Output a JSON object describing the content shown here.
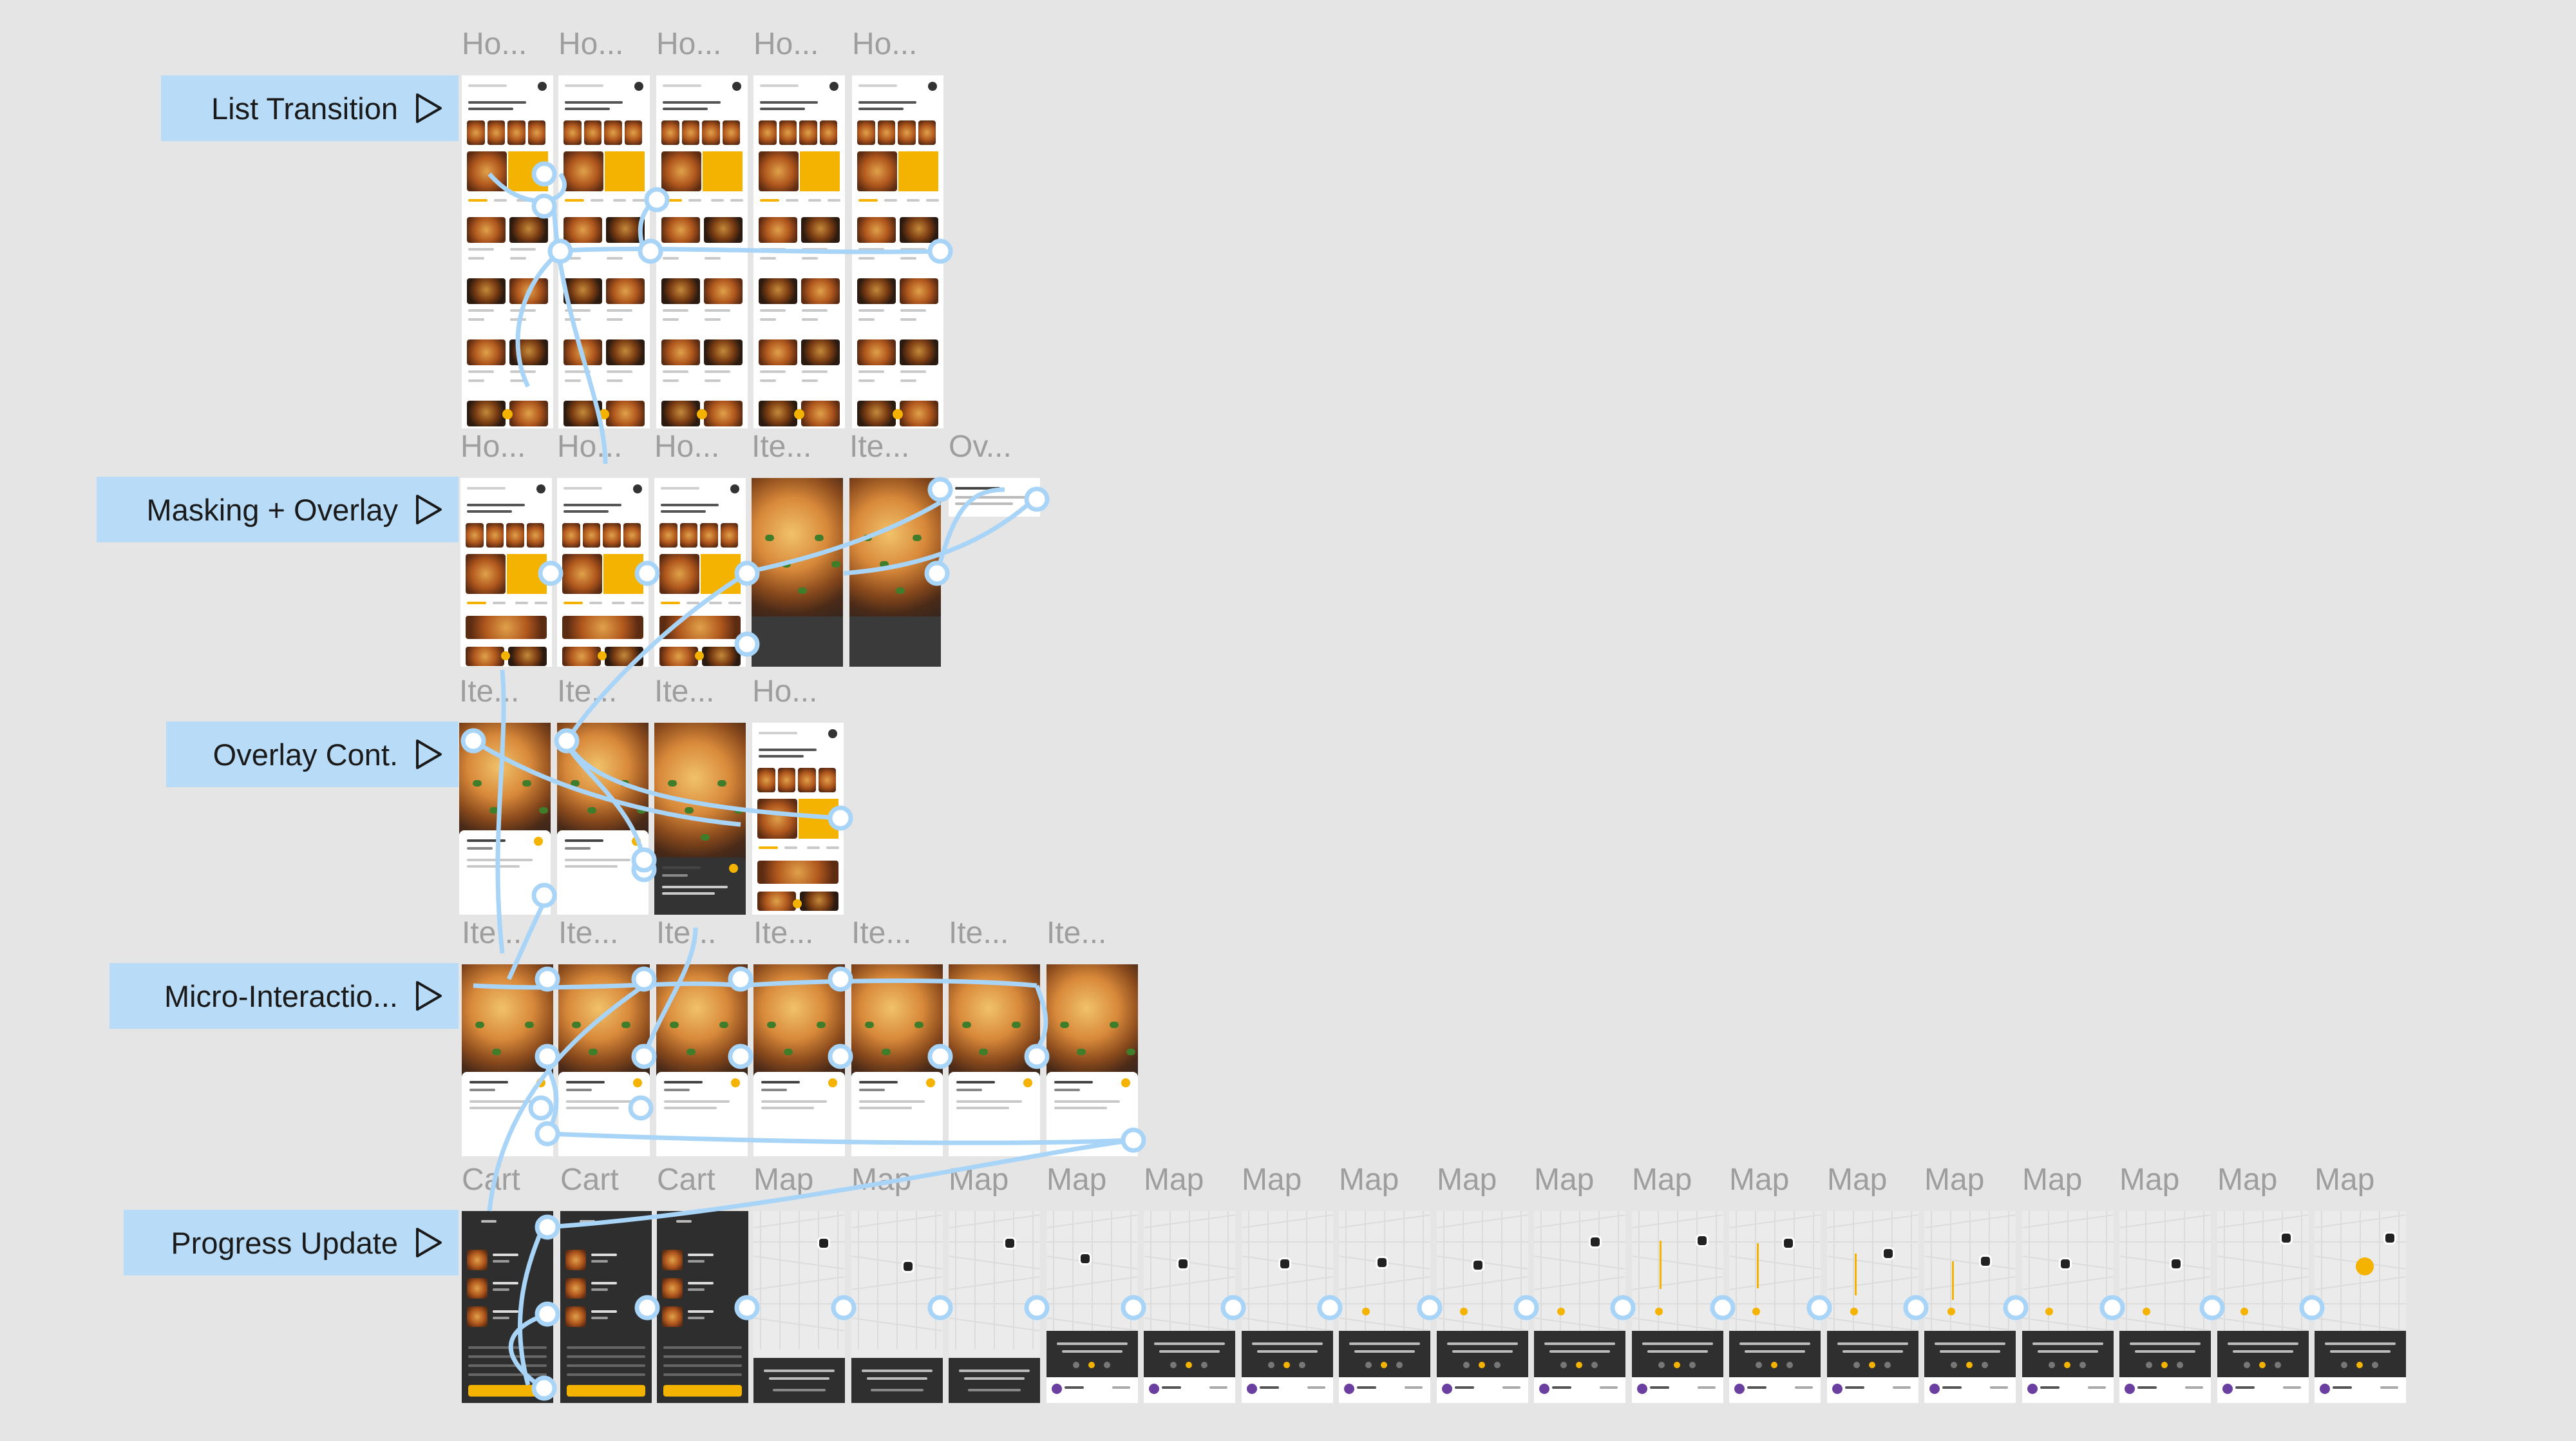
{
  "flows": [
    {
      "id": "list",
      "label": "List Transition"
    },
    {
      "id": "mask",
      "label": "Masking + Overlay"
    },
    {
      "id": "overlay",
      "label": "Overlay Cont."
    },
    {
      "id": "micro",
      "label": "Micro-Interactio..."
    },
    {
      "id": "progress",
      "label": "Progress Update"
    }
  ],
  "frame_names": {
    "row1": [
      "Ho...",
      "Ho...",
      "Ho...",
      "Ho...",
      "Ho..."
    ],
    "row2": [
      "Ho...",
      "Ho...",
      "Ho...",
      "Ite...",
      "Ite...",
      "Ov..."
    ],
    "row3": [
      "Ite...",
      "Ite...",
      "Ite...",
      "Ho..."
    ],
    "row4": [
      "Ite...",
      "Ite...",
      "Ite...",
      "Ite...",
      "Ite...",
      "Ite...",
      "Ite..."
    ],
    "row5": [
      "Cart",
      "Cart",
      "Cart",
      "Map",
      "Map",
      "Map",
      "Map",
      "Map",
      "Map",
      "Map",
      "Map",
      "Map",
      "Map",
      "Map",
      "Map",
      "Map",
      "Map",
      "Map",
      "Map",
      "Map"
    ]
  },
  "icons": {
    "play": "play-triangle-icon"
  },
  "colors": {
    "accent": "#f5b301",
    "flow_label_bg": "#b8dcf8",
    "connector": "#a8d4f7",
    "canvas": "#e5e5e5"
  }
}
